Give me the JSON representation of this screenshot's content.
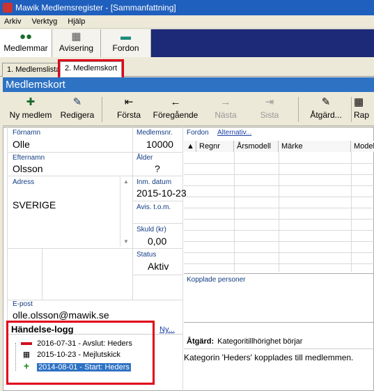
{
  "window": {
    "title": "Mawik Medlemsregister - [Sammanfattning]"
  },
  "menu": [
    "Arkiv",
    "Verktyg",
    "Hjälp"
  ],
  "toolbar": {
    "items": [
      "Medlemmar",
      "Avisering",
      "Fordon"
    ]
  },
  "tabs": [
    "1. Medlemslista",
    "2. Medlemskort"
  ],
  "header": {
    "title": "Medlemskort"
  },
  "actions": {
    "new": "Ny medlem",
    "edit": "Redigera",
    "first": "Första",
    "prev": "Föregående",
    "next": "Nästa",
    "last": "Sista",
    "action": "Åtgärd...",
    "report": "Rap"
  },
  "member": {
    "firstname_label": "Förnamn",
    "firstname": "Olle",
    "number_label": "Medlemsnr.",
    "number": "10000",
    "lastname_label": "Efternamn",
    "lastname": "Olsson",
    "age_label": "Ålder",
    "age": "?",
    "address_label": "Adress",
    "address": "SVERIGE",
    "date_label": "Inm. datum",
    "date": "2015-10-23",
    "avis_label": "Avis. t.o.m.",
    "avis": "",
    "debt_label": "Skuld (kr)",
    "debt": "0,00",
    "status_label": "Status",
    "status": "Aktiv",
    "email_label": "E-post",
    "email": "olle.olsson@mawik.se"
  },
  "vehicles": {
    "label": "Fordon",
    "alt_link": "Alternativ...",
    "columns": [
      "Regnr",
      "Årsmodell",
      "Märke",
      "Modell"
    ]
  },
  "linked": {
    "label": "Kopplade personer"
  },
  "log": {
    "title": "Händelse-logg",
    "new_link": "Ny...",
    "entries": [
      "2016-07-31 - Avslut: Heders",
      "2015-10-23 - Mejlutskick",
      "2014-08-01 - Start: Heders"
    ]
  },
  "detail": {
    "action_label": "Åtgärd:",
    "action_value": "Kategoritillhörighet börjar",
    "text": "Kategorin 'Heders' kopplades till medlemmen."
  }
}
